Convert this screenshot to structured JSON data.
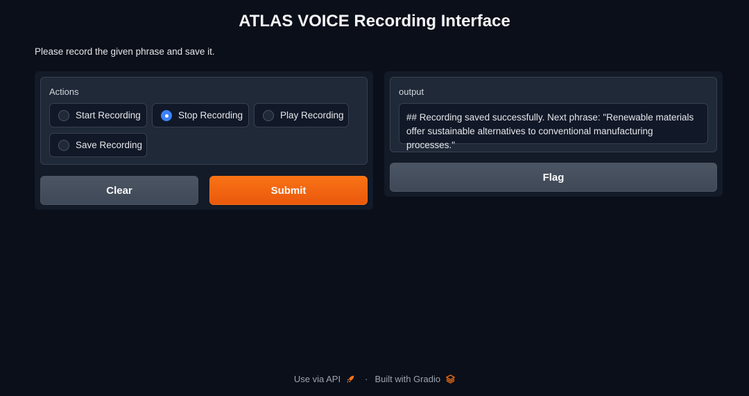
{
  "header": {
    "title": "ATLAS VOICE Recording Interface",
    "description": "Please record the given phrase and save it."
  },
  "actions": {
    "label": "Actions",
    "options": [
      {
        "label": "Start Recording",
        "checked": false
      },
      {
        "label": "Stop Recording",
        "checked": true
      },
      {
        "label": "Play Recording",
        "checked": false
      },
      {
        "label": "Save Recording",
        "checked": false
      }
    ],
    "selected": "Stop Recording"
  },
  "buttons": {
    "clear_label": "Clear",
    "submit_label": "Submit",
    "flag_label": "Flag"
  },
  "output": {
    "label": "output",
    "value": "## Recording saved successfully. Next phrase: \"Renewable materials offer sustainable alternatives to conventional manufacturing processes.\""
  },
  "footer": {
    "api_label": "Use via API",
    "separator": "·",
    "built_with": "Built with Gradio"
  },
  "colors": {
    "background": "#0b0f19",
    "accent": "#f97316",
    "radio_checked": "#3b82f6"
  },
  "icons": [
    "rocket-icon",
    "gradio-logo-icon"
  ]
}
